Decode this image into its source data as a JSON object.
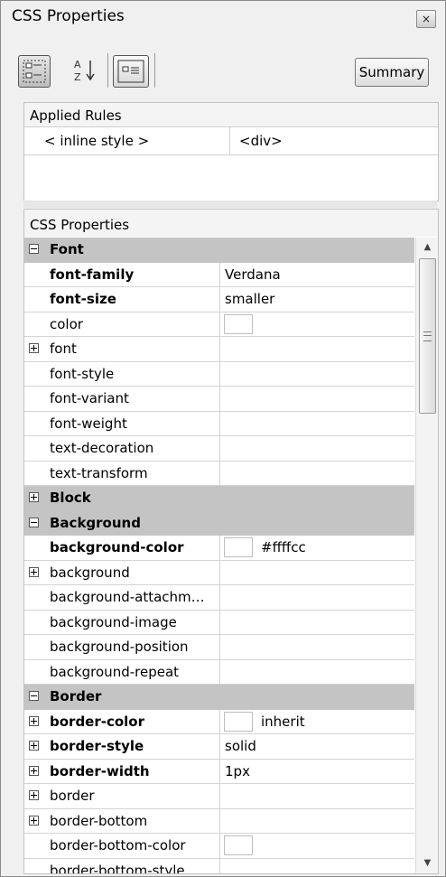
{
  "panel": {
    "title": "CSS Properties",
    "close_icon": "×"
  },
  "toolbar": {
    "summary_label": "Summary",
    "sort_label": "A\nZ"
  },
  "applied_rules": {
    "header": "Applied Rules",
    "rows": [
      {
        "selector": "< inline style >",
        "tag": "<div>"
      }
    ]
  },
  "css_properties": {
    "header": "CSS Properties",
    "rows": [
      {
        "kind": "category",
        "expander": "minus",
        "name": "Font"
      },
      {
        "kind": "prop",
        "bold": true,
        "name": "font-family",
        "value": "Verdana"
      },
      {
        "kind": "prop",
        "bold": true,
        "name": "font-size",
        "value": "smaller"
      },
      {
        "kind": "prop",
        "name": "color",
        "swatch": true,
        "value": ""
      },
      {
        "kind": "prop",
        "expander": "plus",
        "name": "font",
        "value": ""
      },
      {
        "kind": "prop",
        "name": "font-style",
        "value": ""
      },
      {
        "kind": "prop",
        "name": "font-variant",
        "value": ""
      },
      {
        "kind": "prop",
        "name": "font-weight",
        "value": ""
      },
      {
        "kind": "prop",
        "name": "text-decoration",
        "value": ""
      },
      {
        "kind": "prop",
        "name": "text-transform",
        "value": ""
      },
      {
        "kind": "category",
        "expander": "plus",
        "name": "Block"
      },
      {
        "kind": "category",
        "expander": "minus",
        "name": "Background"
      },
      {
        "kind": "prop",
        "bold": true,
        "name": "background-color",
        "swatch": true,
        "value": "#ffffcc"
      },
      {
        "kind": "prop",
        "expander": "plus",
        "name": "background",
        "value": ""
      },
      {
        "kind": "prop",
        "name": "background-attachm…",
        "value": ""
      },
      {
        "kind": "prop",
        "name": "background-image",
        "value": ""
      },
      {
        "kind": "prop",
        "name": "background-position",
        "value": ""
      },
      {
        "kind": "prop",
        "name": "background-repeat",
        "value": ""
      },
      {
        "kind": "category",
        "expander": "minus",
        "name": "Border"
      },
      {
        "kind": "prop",
        "bold": true,
        "expander": "plus",
        "name": "border-color",
        "swatch": true,
        "value": "inherit"
      },
      {
        "kind": "prop",
        "bold": true,
        "expander": "plus",
        "name": "border-style",
        "value": "solid"
      },
      {
        "kind": "prop",
        "bold": true,
        "expander": "plus",
        "name": "border-width",
        "value": "1px"
      },
      {
        "kind": "prop",
        "expander": "plus",
        "name": "border",
        "value": ""
      },
      {
        "kind": "prop",
        "expander": "plus",
        "name": "border-bottom",
        "value": ""
      },
      {
        "kind": "prop",
        "name": "border-bottom-color",
        "swatch": true,
        "value": ""
      },
      {
        "kind": "prop",
        "name": "border-bottom-style",
        "value": ""
      }
    ]
  },
  "scrollbar": {
    "up_arrow": "▲",
    "down_arrow": "▼"
  }
}
